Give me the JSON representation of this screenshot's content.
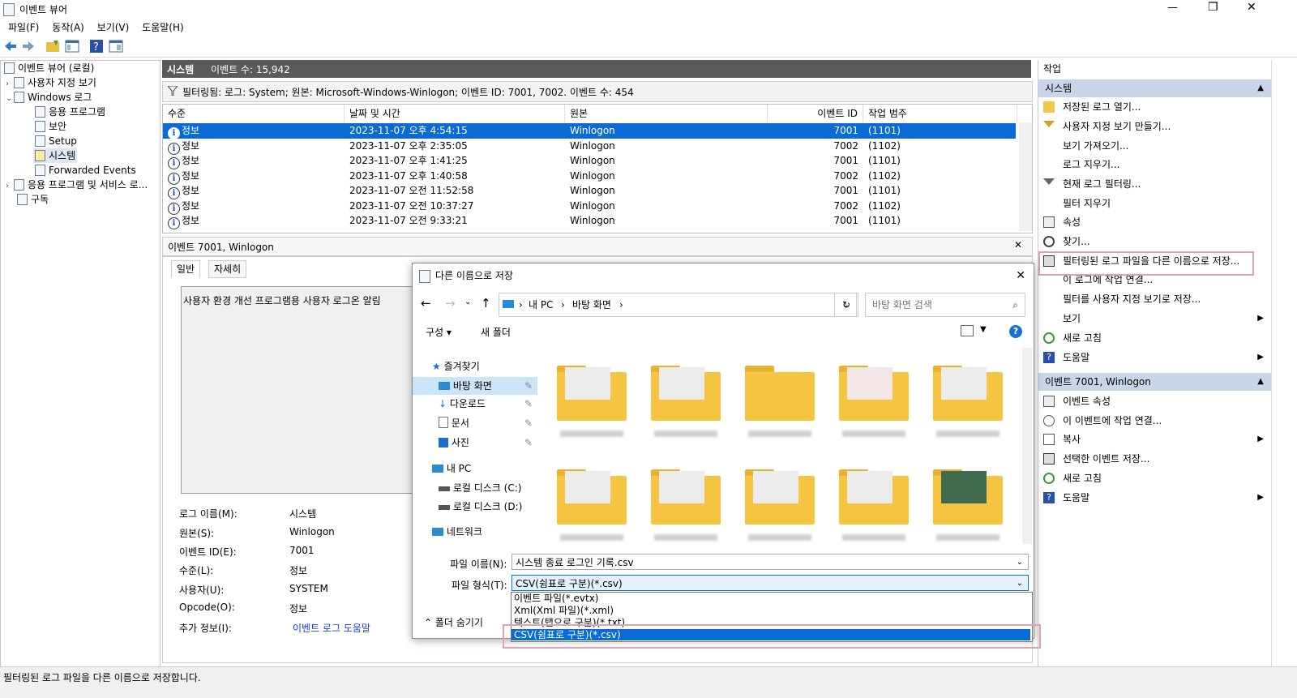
{
  "window": {
    "title": "이벤트 뷰어",
    "min": "—",
    "max": "❐",
    "close": "✕"
  },
  "menu": [
    "파일(F)",
    "동작(A)",
    "보기(V)",
    "도움말(H)"
  ],
  "tree": {
    "root": "이벤트 뷰어 (로컬)",
    "custom_views": "사용자 지정 보기",
    "windows_logs": "Windows 로그",
    "logs": [
      "응용 프로그램",
      "보안",
      "Setup",
      "시스템",
      "Forwarded Events"
    ],
    "apps_services": "응용 프로그램 및 서비스 로...",
    "subscriptions": "구독"
  },
  "center": {
    "log_name": "시스템",
    "event_count": "이벤트 수: 15,942",
    "filter_text": "필터링됨: 로그: System; 원본: Microsoft-Windows-Winlogon; 이벤트 ID: 7001, 7002. 이벤트 수: 454",
    "columns": [
      "수준",
      "날짜 및 시간",
      "원본",
      "이벤트 ID",
      "작업 범주"
    ],
    "rows": [
      {
        "level": "정보",
        "date": "2023-11-07 오후 4:54:15",
        "source": "Winlogon",
        "id": "7001",
        "cat": "(1101)"
      },
      {
        "level": "정보",
        "date": "2023-11-07 오후 2:35:05",
        "source": "Winlogon",
        "id": "7002",
        "cat": "(1102)"
      },
      {
        "level": "정보",
        "date": "2023-11-07 오후 1:41:25",
        "source": "Winlogon",
        "id": "7001",
        "cat": "(1101)"
      },
      {
        "level": "정보",
        "date": "2023-11-07 오후 1:40:58",
        "source": "Winlogon",
        "id": "7002",
        "cat": "(1102)"
      },
      {
        "level": "정보",
        "date": "2023-11-07 오전 11:52:58",
        "source": "Winlogon",
        "id": "7001",
        "cat": "(1101)"
      },
      {
        "level": "정보",
        "date": "2023-11-07 오전 10:37:27",
        "source": "Winlogon",
        "id": "7002",
        "cat": "(1102)"
      },
      {
        "level": "정보",
        "date": "2023-11-07 오전 9:33:21",
        "source": "Winlogon",
        "id": "7001",
        "cat": "(1101)"
      }
    ]
  },
  "detail": {
    "title": "이벤트 7001, Winlogon",
    "tabs": [
      "일반",
      "자세히"
    ],
    "description": "사용자 환경 개선 프로그램용 사용자 로그온 알림",
    "props": [
      {
        "k": "로그 이름(M):",
        "v": "시스템"
      },
      {
        "k": "원본(S):",
        "v": "Winlogon"
      },
      {
        "k": "이벤트 ID(E):",
        "v": "7001"
      },
      {
        "k": "수준(L):",
        "v": "정보"
      },
      {
        "k": "사용자(U):",
        "v": "SYSTEM"
      },
      {
        "k": "Opcode(O):",
        "v": "정보"
      },
      {
        "k": "추가 정보(I):",
        "v": "이벤트 로그 도움말"
      }
    ]
  },
  "status": "필터링된 로그 파일을 다른 이름으로 저장합니다.",
  "actions": {
    "header": "작업",
    "section1": "시스템",
    "items1": [
      "저장된 로그 열기...",
      "사용자 지정 보기 만들기...",
      "보기 가져오기...",
      "로그 지우기...",
      "현재 로그 필터링...",
      "필터 지우기",
      "속성",
      "찾기...",
      "필터링된 로그 파일을 다른 이름으로 저장...",
      "이 로그에 작업 연결...",
      "필터를 사용자 지정 보기로 저장...",
      "보기",
      "새로 고침",
      "도움말"
    ],
    "section2": "이벤트 7001, Winlogon",
    "items2": [
      "이벤트 속성",
      "이 이벤트에 작업 연결...",
      "복사",
      "선택한 이벤트 저장...",
      "새로 고침",
      "도움말"
    ]
  },
  "dialog": {
    "title": "다른 이름으로 저장",
    "path": [
      "내 PC",
      "바탕 화면"
    ],
    "search_placeholder": "바탕 화면 검색",
    "organize": "구성 ▾",
    "new_folder": "새 폴더",
    "nav": [
      "즐겨찾기",
      "바탕 화면",
      "다운로드",
      "문서",
      "사진",
      "내 PC",
      "로컬 디스크 (C:)",
      "로컬 디스크 (D:)",
      "네트워크"
    ],
    "filename_label": "파일 이름(N):",
    "filename": "시스템 종료 로그인 기록.csv",
    "filetype_label": "파일 형식(T):",
    "filetype": "CSV(쉼표로 구분)(*.csv)",
    "filetype_options": [
      "이벤트 파일(*.evtx)",
      "Xml(Xml 파일)(*.xml)",
      "텍스트(탭으로 구분)(*.txt)",
      "CSV(쉼표로 구분)(*.csv)"
    ],
    "hide_folders": "폴더 숨기기"
  }
}
